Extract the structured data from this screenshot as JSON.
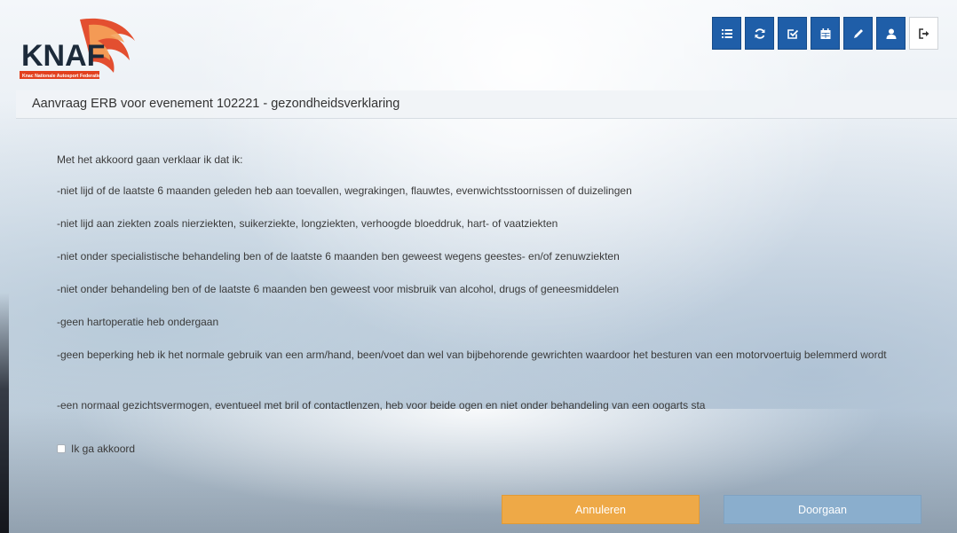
{
  "logo": {
    "text": "KNAF",
    "subtitle": "Knac Nationale Autosport Federatie"
  },
  "toolbar": {
    "buttons": [
      {
        "icon": "list-icon"
      },
      {
        "icon": "refresh-icon"
      },
      {
        "icon": "check-square-icon"
      },
      {
        "icon": "calendar-icon"
      },
      {
        "icon": "pencil-icon"
      },
      {
        "icon": "user-icon"
      },
      {
        "icon": "logout-icon"
      }
    ]
  },
  "page": {
    "title": "Aanvraag ERB voor evenement 102221 - gezondheidsverklaring"
  },
  "declaration": {
    "intro": "Met het akkoord gaan verklaar ik dat ik:",
    "items": [
      "-niet lijd of de laatste 6 maanden geleden heb aan toevallen, wegrakingen, flauwtes, evenwichtsstoornissen of duizelingen",
      "-niet lijd aan ziekten zoals nierziekten, suikerziekte, longziekten, verhoogde bloeddruk, hart- of vaatziekten",
      "-niet onder specialistische behandeling ben of de laatste 6 maanden ben geweest wegens geestes- en/of zenuwziekten",
      "-niet onder behandeling ben of de laatste 6 maanden ben geweest voor misbruik van alcohol, drugs of geneesmiddelen",
      "-geen hartoperatie heb ondergaan",
      "-geen beperking heb ik het normale gebruik van een arm/hand, been/voet dan wel van bijbehorende gewrichten waardoor het besturen van een motorvoertuig belemmerd wordt",
      "-een normaal gezichtsvermogen, eventueel met bril of contactlenzen, heb voor beide ogen en niet onder behandeling van een oogarts sta"
    ]
  },
  "agree": {
    "label": "Ik ga akkoord",
    "checked": false
  },
  "actions": {
    "cancel_label": "Annuleren",
    "continue_label": "Doorgaan"
  },
  "colors": {
    "toolbar_blue": "#1f5ea8",
    "cancel_orange": "#eea947",
    "continue_blue": "#8aaecd",
    "logo_red": "#e2401e"
  }
}
